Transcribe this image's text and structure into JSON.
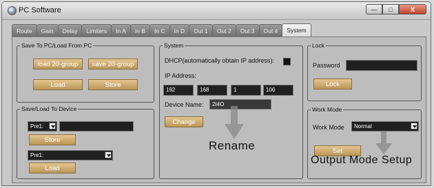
{
  "window": {
    "title": "PC Software",
    "min_label": "—",
    "max_label": "□",
    "close_label": "X"
  },
  "tabs": [
    "Route",
    "Gain",
    "Delay",
    "Limiters",
    "In A",
    "In B",
    "In C",
    "In D",
    "Out 1",
    "Out 2",
    "Out 3",
    "Out 4",
    "System"
  ],
  "active_tab": "System",
  "save_pc": {
    "legend": "Save To PC/Load From PC",
    "load20_label": "load 20-group",
    "save20_label": "save 20-group",
    "load_label": "Load",
    "store_label": "Store"
  },
  "save_device": {
    "legend": "Save/Load To Device",
    "preset1_label": "Pre1:",
    "preset1_name": "",
    "store_label": "Store",
    "preset2_label": "Pre1:",
    "load_label": "Load"
  },
  "system": {
    "legend": "System",
    "dhcp_label": "DHCP(automatically obtain IP address):",
    "ip_label": "IP Address:",
    "ip": [
      "192",
      "168",
      "1",
      "100"
    ],
    "device_name_label": "Device Name:",
    "device_name": "2I4O",
    "change_label": "Change"
  },
  "lock": {
    "legend": "Lock",
    "password_label": "Password",
    "password_value": "",
    "lock_label": "Lock"
  },
  "workmode": {
    "legend": "Work Mode",
    "mode_label": "Work Mode",
    "mode_value": "Normal",
    "set_label": "Set"
  },
  "annotations": {
    "rename": "Rename",
    "output_mode_setup": "Output Mode Setup"
  },
  "colors": {
    "gold_button": "#c9a86a",
    "field_bg": "#202020",
    "panel_bg": "#bdbdbd",
    "close_red": "#c2402a"
  }
}
